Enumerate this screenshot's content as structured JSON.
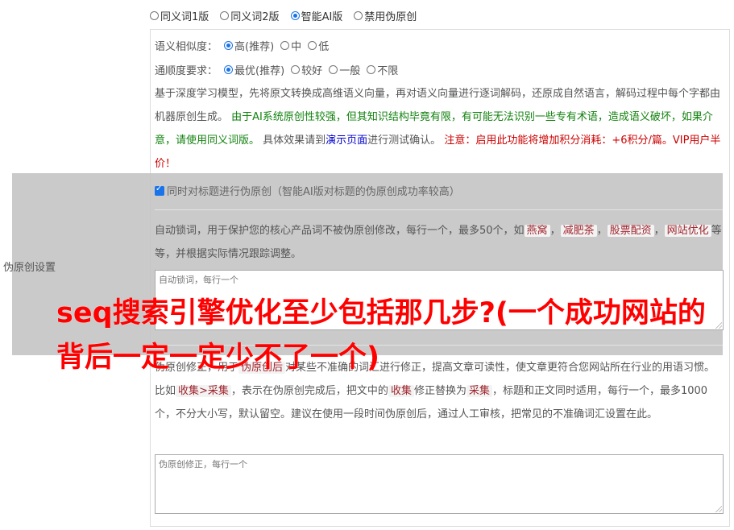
{
  "version_options": [
    {
      "label": "同义词1版",
      "selected": false
    },
    {
      "label": "同义词2版",
      "selected": false
    },
    {
      "label": "智能AI版",
      "selected": true
    },
    {
      "label": "禁用伪原创",
      "selected": false
    }
  ],
  "similarity": {
    "label": "语义相似度：",
    "options": [
      {
        "label": "高(推荐)",
        "selected": true
      },
      {
        "label": "中",
        "selected": false
      },
      {
        "label": "低",
        "selected": false
      }
    ]
  },
  "fluency": {
    "label": "通顺度要求：",
    "options": [
      {
        "label": "最优(推荐)",
        "selected": true
      },
      {
        "label": "较好",
        "selected": false
      },
      {
        "label": "一般",
        "selected": false
      },
      {
        "label": "不限",
        "selected": false
      }
    ]
  },
  "description": {
    "part1": "基于深度学习模型，先将原文转换成高维语义向量，再对语义向量进行逐词解码，还原成自然语言，解码过程中每个字都由机器原创生成。 ",
    "part2_green": "由于AI系统原创性较强，但其知识结构毕竟有限，有可能无法识别一些专有术语，造成语义破坏，如果介意，请使用同义词版。",
    "part3": " 具体效果请到",
    "demo_link": "演示页面",
    "part4": "进行测试确认。 ",
    "part5_red": "注意：启用此功能将增加积分消耗：+6积分/篇。VIP用户半价！"
  },
  "title_checkbox": {
    "checked": true,
    "label": "同时对标题进行伪原创（智能AI版对标题的伪原创成功率较高）"
  },
  "side_label": "伪原创设置",
  "lock_words": {
    "intro": "自动锁词，用于保护您的核心产品词不被伪原创修改，每行一个，最多50个，如",
    "examples": [
      "燕窝",
      "减肥茶",
      "股票配资",
      "网站优化"
    ],
    "sep": "，",
    "outro": "等等，并根据实际情况跟踪调整。",
    "placeholder": "自动锁词，每行一个"
  },
  "correction": {
    "intro": "伪原创修正，用于",
    "tag_a": "伪原创后",
    "mid": "对某些不准确的词汇进行修正，提高文章可读性，使文章更符合您网站所在行业的用语习惯。比如",
    "example1": "收集>采集",
    "mid2": "，表示在伪原创完成后，把文中的",
    "example2": "收集",
    "mid3": "修正替换为",
    "example3": "采集",
    "outro": "，标题和正文同时适用，每行一个，最多1000个，不分大小写，默认留空。建议在使用一段时间伪原创后，通过人工审核，把常见的不准确词汇设置在此。",
    "placeholder": "伪原创修正，每行一个"
  },
  "overlay_title": "seq搜索引擎优化至少包括那几步?(一个成功网站的背后一定一定少不了一个)"
}
